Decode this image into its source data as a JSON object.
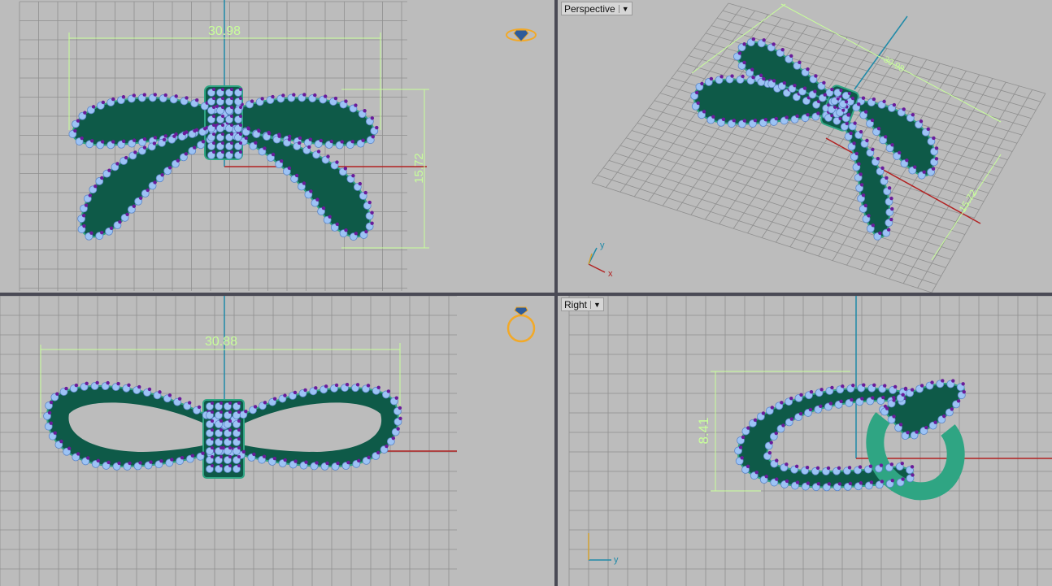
{
  "viewports": {
    "top": {
      "dimension_width": "30.98",
      "dimension_height": "15.72"
    },
    "perspective": {
      "label": "Perspective",
      "dimension_width": "30.98",
      "dimension_height": "15.72",
      "axis_x": "x",
      "axis_y": "y"
    },
    "front": {
      "dimension_width": "30.88"
    },
    "right": {
      "label": "Right",
      "dimension_height": "8.41",
      "axis_y": "y"
    }
  },
  "colors": {
    "band": "#0e5a48",
    "band_light": "#2fa583",
    "gem": "#9cc3f5",
    "prong": "#6a1b9a",
    "dimension": "#c8ff9a",
    "axis_x": "#b22222",
    "axis_y": "#1f8aa8",
    "grid": "#8f8f8f",
    "icon": "#f2a928"
  }
}
